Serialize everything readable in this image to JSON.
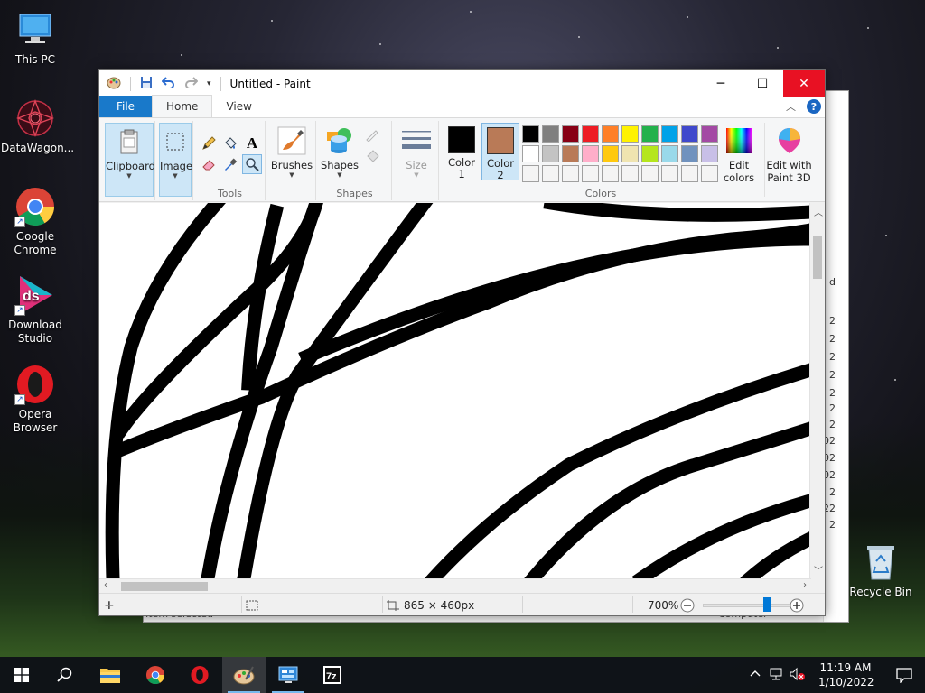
{
  "desktop": {
    "icons": [
      {
        "label": "This PC"
      },
      {
        "label": "DataWagon..."
      },
      {
        "label": "Google Chrome"
      },
      {
        "label": "Download Studio"
      },
      {
        "label": "Opera Browser"
      },
      {
        "label": "Recycle Bin"
      }
    ]
  },
  "background_window": {
    "numbers": [
      "2",
      "2",
      "2",
      "2",
      "2",
      "2",
      "2",
      "02",
      "02",
      "02",
      "2",
      "22",
      "2"
    ],
    "d_label": "d",
    "status_left": "Item selected",
    "status_right": "Computer"
  },
  "paint": {
    "title": "Untitled - Paint",
    "tabs": {
      "file": "File",
      "home": "Home",
      "view": "View"
    },
    "groups": {
      "clipboard": "Clipboard",
      "image": "Image",
      "tools": "Tools",
      "brushes": "Brushes",
      "shapes": "Shapes",
      "size": "Size",
      "colors": "Colors"
    },
    "buttons": {
      "color1": [
        "Color",
        "1"
      ],
      "color2": [
        "Color",
        "2"
      ],
      "edit_colors": [
        "Edit",
        "colors"
      ],
      "edit_3d": [
        "Edit with",
        "Paint 3D"
      ]
    },
    "active_colors": {
      "color1": "#000000",
      "color2": "#b97a57"
    },
    "palette": [
      "#000000",
      "#7f7f7f",
      "#880015",
      "#ed1c24",
      "#ff7f27",
      "#fff200",
      "#22b14c",
      "#00a2e8",
      "#3f48cc",
      "#a349a4",
      "#ffffff",
      "#c3c3c3",
      "#b97a57",
      "#ffaec9",
      "#ffc90e",
      "#efe4b0",
      "#b5e61d",
      "#99d9ea",
      "#7092be",
      "#c8bfe7",
      "#f4f4f4",
      "#f4f4f4",
      "#f4f4f4",
      "#f4f4f4",
      "#f4f4f4",
      "#f4f4f4",
      "#f4f4f4",
      "#f4f4f4",
      "#f4f4f4",
      "#f4f4f4"
    ],
    "status": {
      "dimensions": "865 × 460px",
      "zoom": "700%",
      "zoom_level": 0.72
    }
  },
  "taskbar": {
    "time": "11:19 AM",
    "date": "1/10/2022"
  }
}
